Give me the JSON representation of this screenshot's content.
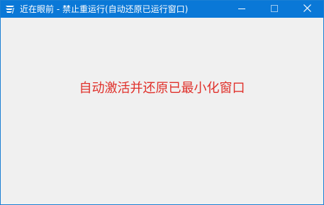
{
  "window": {
    "title": "近在眼前 - 禁止重运行(自动还原已运行窗口)",
    "icons": {
      "app": "app-logo-icon",
      "minimize": "minimize-icon",
      "maximize": "maximize-icon",
      "close": "close-icon"
    },
    "colors": {
      "titlebar": "#0a78d7",
      "border": "#1a7fd4",
      "client": "#f0f0f0",
      "message": "#e0302a"
    }
  },
  "main": {
    "message": "自动激活并还原已最小化窗口"
  }
}
